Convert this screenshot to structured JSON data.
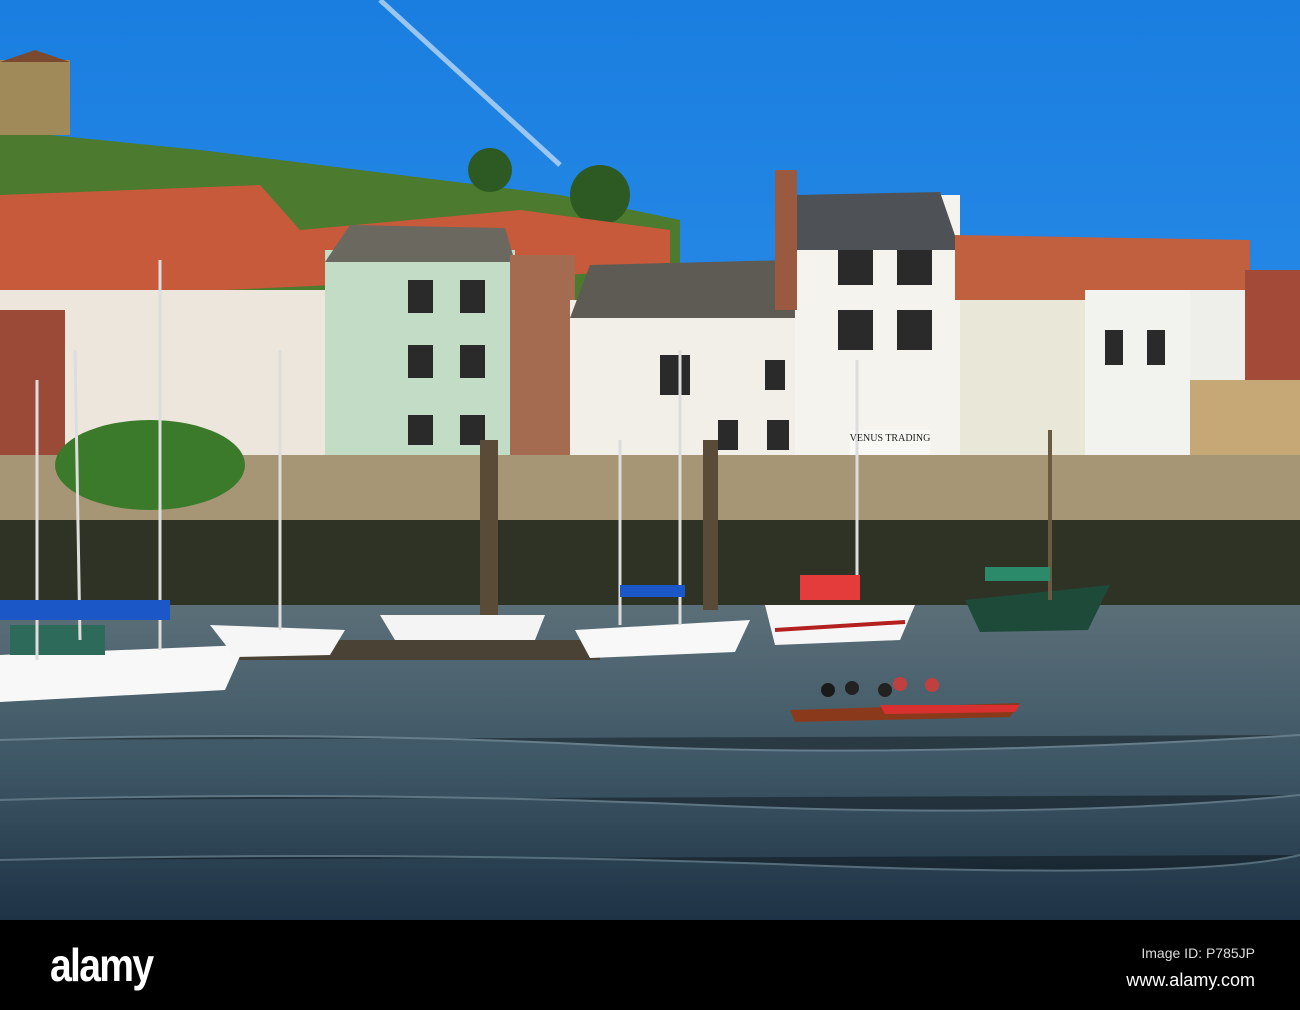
{
  "photo": {
    "subject": "Harbour with moored sailing boats and rowing crew",
    "sign_text": "VENUS TRADING"
  },
  "watermark": {
    "logo": "alamy",
    "image_id": "Image ID: P785JP",
    "url": "www.alamy.com"
  }
}
